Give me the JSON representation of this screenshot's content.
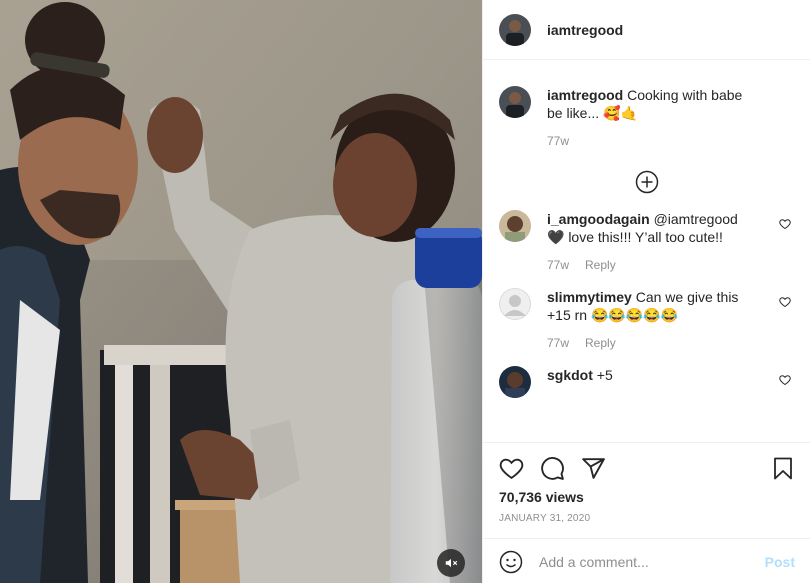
{
  "post": {
    "author": "iamtregood",
    "caption": "Cooking with babe be like... 🥰🤙",
    "caption_age": "77w",
    "views": "70,736 views",
    "date": "JANUARY 31, 2020"
  },
  "comments": [
    {
      "user": "i_amgoodagain",
      "text": "@iamtregood 🖤 love this!!! Y’all too cute!!",
      "age": "77w",
      "reply": "Reply"
    },
    {
      "user": "slimmytimey",
      "text": "Can we give this +15 rn 😂😂😂😂😂",
      "age": "77w",
      "reply": "Reply"
    },
    {
      "user": "sgkdot",
      "text": "+5"
    }
  ],
  "composer": {
    "placeholder": "Add a comment...",
    "post_label": "Post"
  },
  "icons": [
    "heart-icon",
    "comment-icon",
    "share-icon",
    "bookmark-icon",
    "smiley-icon",
    "plus-circle-icon",
    "mute-icon"
  ]
}
